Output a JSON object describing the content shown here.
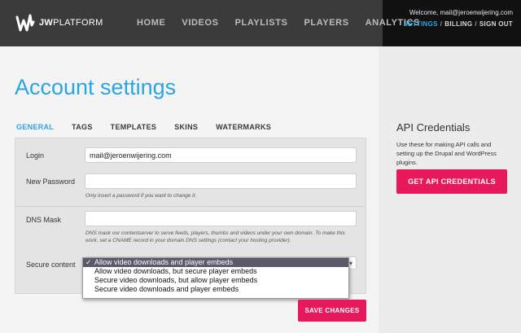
{
  "header": {
    "brand_bold": "JW",
    "brand_rest": "PLATFORM",
    "nav": [
      "HOME",
      "VIDEOS",
      "PLAYLISTS",
      "PLAYERS",
      "ANALYTICS"
    ],
    "welcome": "Welcome, mail@jeroenwijering.com",
    "account_links": {
      "settings": "SETTINGS",
      "billing": "BILLING",
      "signout": "SIGN OUT",
      "separator": "/"
    }
  },
  "page": {
    "title": "Account settings",
    "tabs": [
      "GENERAL",
      "TAGS",
      "TEMPLATES",
      "SKINS",
      "WATERMARKS"
    ],
    "active_tab": "GENERAL"
  },
  "form": {
    "login_label": "Login",
    "login_value": "mail@jeroenwijering.com",
    "password_label": "New Password",
    "password_value": "",
    "password_help": "Only insert a password if you want to change it.",
    "dns_label": "DNS Mask",
    "dns_value": "",
    "dns_help": "DNS mask our contentserver to serve feeds, players, thumbs and videos under your own domain. To make this work, set a CNAME record in your domain DNS settings (contact your hosting provider).",
    "secure_label": "Secure content",
    "secure_options": [
      "Allow video downloads and player embeds",
      "Allow video downloads, but secure player embeds",
      "Secure video downloads, but allow player embeds",
      "Secure video downloads and player embeds"
    ],
    "secure_selected_index": 0,
    "check_mark": "✓",
    "save_label": "SAVE CHANGES"
  },
  "sidebar": {
    "title": "API Credentials",
    "description": "Use these for making API calls and setting up the Drupal and WordPress plugins.",
    "button_label": "GET API CREDENTIALS"
  },
  "colors": {
    "accent_blue": "#2aa5e3",
    "accent_pink": "#e8195a",
    "topbar": "#3b3b3b"
  }
}
